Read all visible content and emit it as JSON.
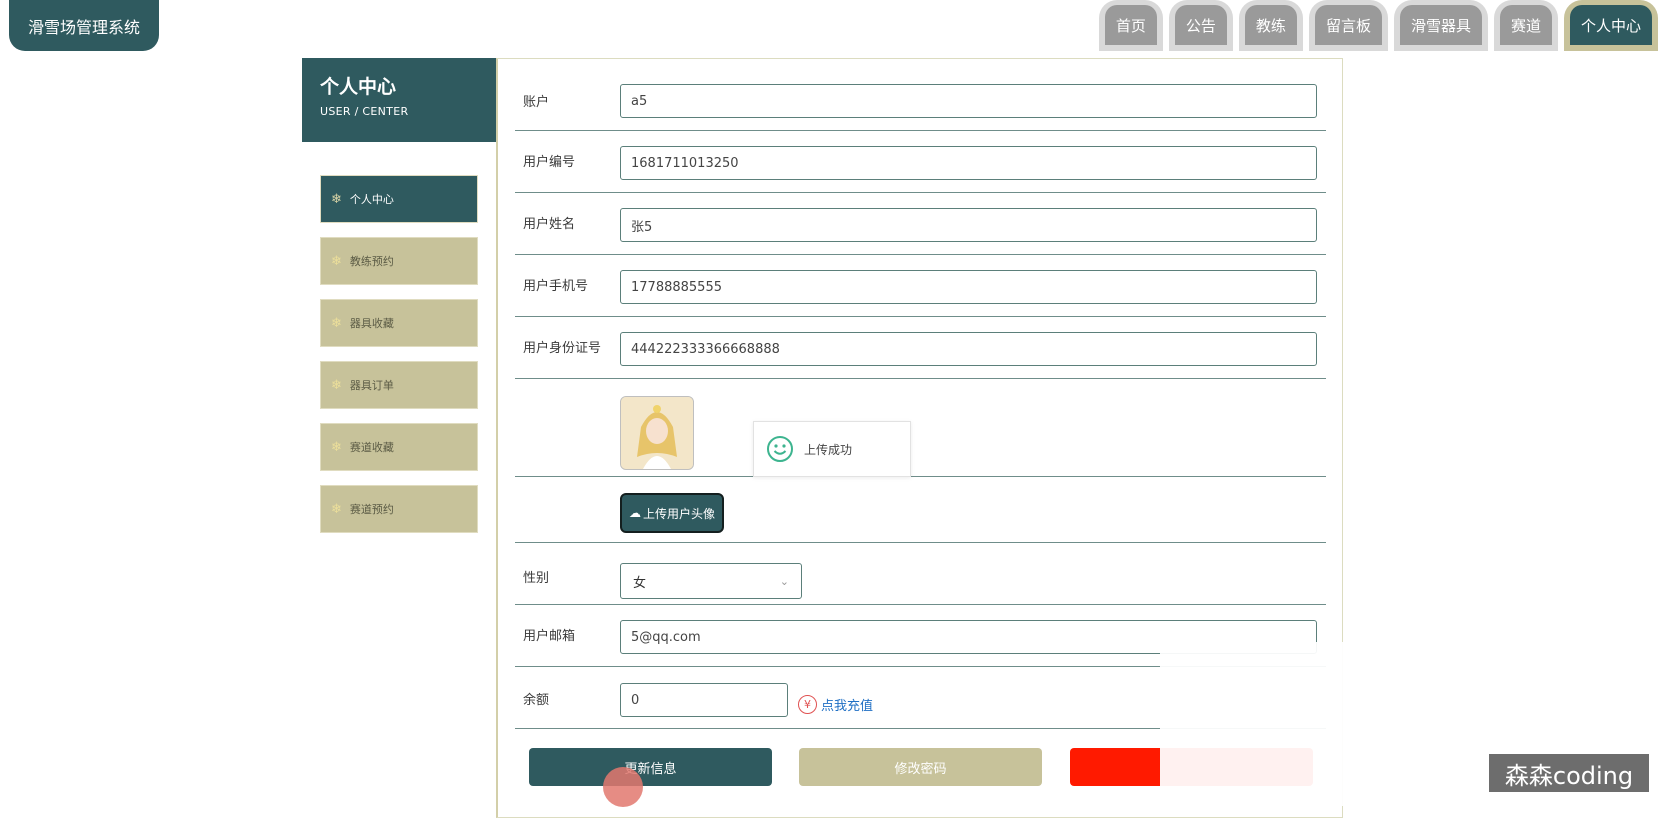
{
  "app": {
    "title": "滑雪场管理系统"
  },
  "nav": {
    "tabs": [
      {
        "label": "首页"
      },
      {
        "label": "公告"
      },
      {
        "label": "教练"
      },
      {
        "label": "留言板"
      },
      {
        "label": "滑雪器具"
      },
      {
        "label": "赛道"
      },
      {
        "label": "个人中心",
        "active": true
      }
    ]
  },
  "sidebar": {
    "title": "个人中心",
    "subtitle": "USER / CENTER",
    "items": [
      {
        "label": "个人中心",
        "active": true
      },
      {
        "label": "教练预约"
      },
      {
        "label": "器具收藏"
      },
      {
        "label": "器具订单"
      },
      {
        "label": "赛道收藏"
      },
      {
        "label": "赛道预约"
      }
    ]
  },
  "form": {
    "account": {
      "label": "账户",
      "value": "a5"
    },
    "user_no": {
      "label": "用户编号",
      "value": "1681711013250"
    },
    "user_name": {
      "label": "用户姓名",
      "value": "张5"
    },
    "phone": {
      "label": "用户手机号",
      "value": "17788885555"
    },
    "id_card": {
      "label": "用户身份证号",
      "value": "444222333366668888"
    },
    "upload_avatar": "上传用户头像",
    "gender": {
      "label": "性别",
      "value": "女"
    },
    "email": {
      "label": "用户邮箱",
      "value": "5@qq.com"
    },
    "balance": {
      "label": "余额",
      "value": "0",
      "recharge": "点我充值"
    }
  },
  "toast": {
    "text": "上传成功"
  },
  "buttons": {
    "update": "更新信息",
    "change_password": "修改密码"
  },
  "watermark": "森森coding",
  "colors": {
    "primary": "#2f5a5f",
    "khaki": "#c7c29a",
    "danger": "#ff1a00",
    "link": "#1f6fc4"
  }
}
